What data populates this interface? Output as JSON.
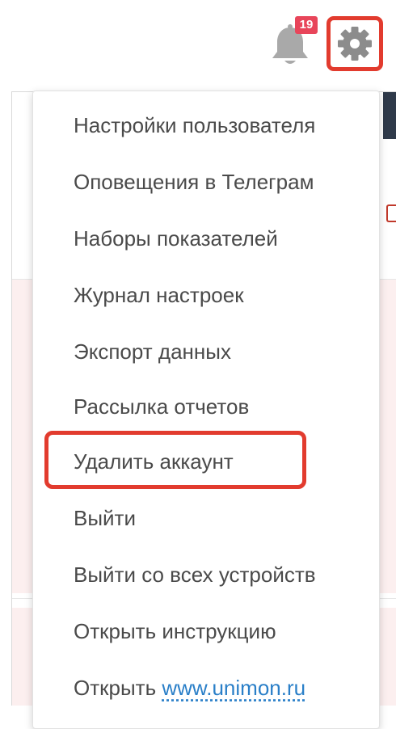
{
  "header": {
    "notifications_count": "19",
    "bell_icon": "bell-icon",
    "settings_icon": "gear-icon",
    "accent_color": "#e23b2e",
    "badge_color": "#e8455a"
  },
  "menu": {
    "items": [
      {
        "label": "Настройки пользователя"
      },
      {
        "label": "Оповещения в Телеграм"
      },
      {
        "label": "Наборы показателей"
      },
      {
        "label": "Журнал настроек"
      },
      {
        "label": "Экспорт данных"
      },
      {
        "label": "Рассылка отчетов"
      },
      {
        "label": "Удалить аккаунт"
      },
      {
        "label": "Выйти"
      },
      {
        "label": "Выйти со всех устройств"
      },
      {
        "label": "Открыть инструкцию"
      },
      {
        "label_prefix": "Открыть ",
        "link": "www.unimon.ru"
      }
    ],
    "highlighted_item": "Удалить аккаунт",
    "link_color": "#2a7fc8",
    "text_color": "#4a4a4a"
  }
}
